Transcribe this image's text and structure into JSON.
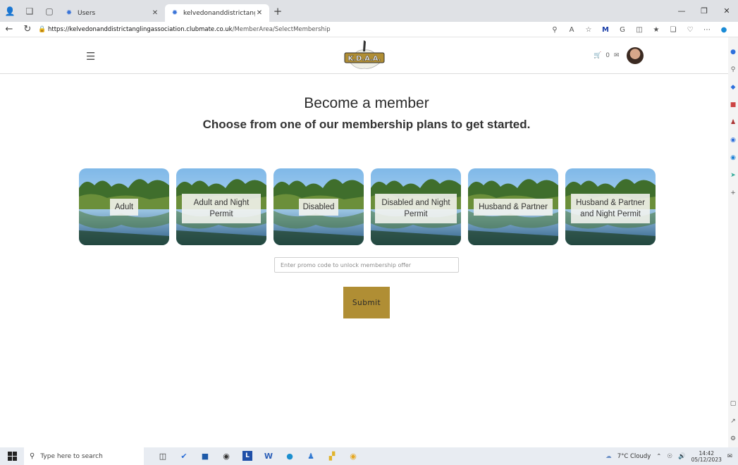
{
  "browser": {
    "tabs": [
      {
        "label": "Users",
        "active": false
      },
      {
        "label": "kelvedonanddistrictanglingassoc",
        "active": true
      }
    ],
    "url_host": "https://kelvedonanddistrictanglingassociation.clubmate.co.uk",
    "url_path": "/MemberArea/SelectMembership",
    "new_tab": "+"
  },
  "header": {
    "logo_text": "K.D.A.A.",
    "basket_count": "0"
  },
  "main": {
    "title": "Become a member",
    "subtitle": "Choose from one of our membership plans to get started.",
    "plans": [
      {
        "label": "Adult"
      },
      {
        "label": "Adult and Night Permit"
      },
      {
        "label": "Disabled"
      },
      {
        "label": "Disabled and Night Permit"
      },
      {
        "label": "Husband & Partner"
      },
      {
        "label": "Husband & Partner and Night Permit"
      }
    ],
    "promo_placeholder": "Enter promo code to unlock membership offer",
    "submit_label": "Submit"
  },
  "taskbar": {
    "search_placeholder": "Type here to search",
    "weather": "7°C  Cloudy",
    "time": "14:42",
    "date": "05/12/2023"
  },
  "colors": {
    "submit_bg": "#b08e34",
    "tab_bar": "#dfe1e5"
  }
}
